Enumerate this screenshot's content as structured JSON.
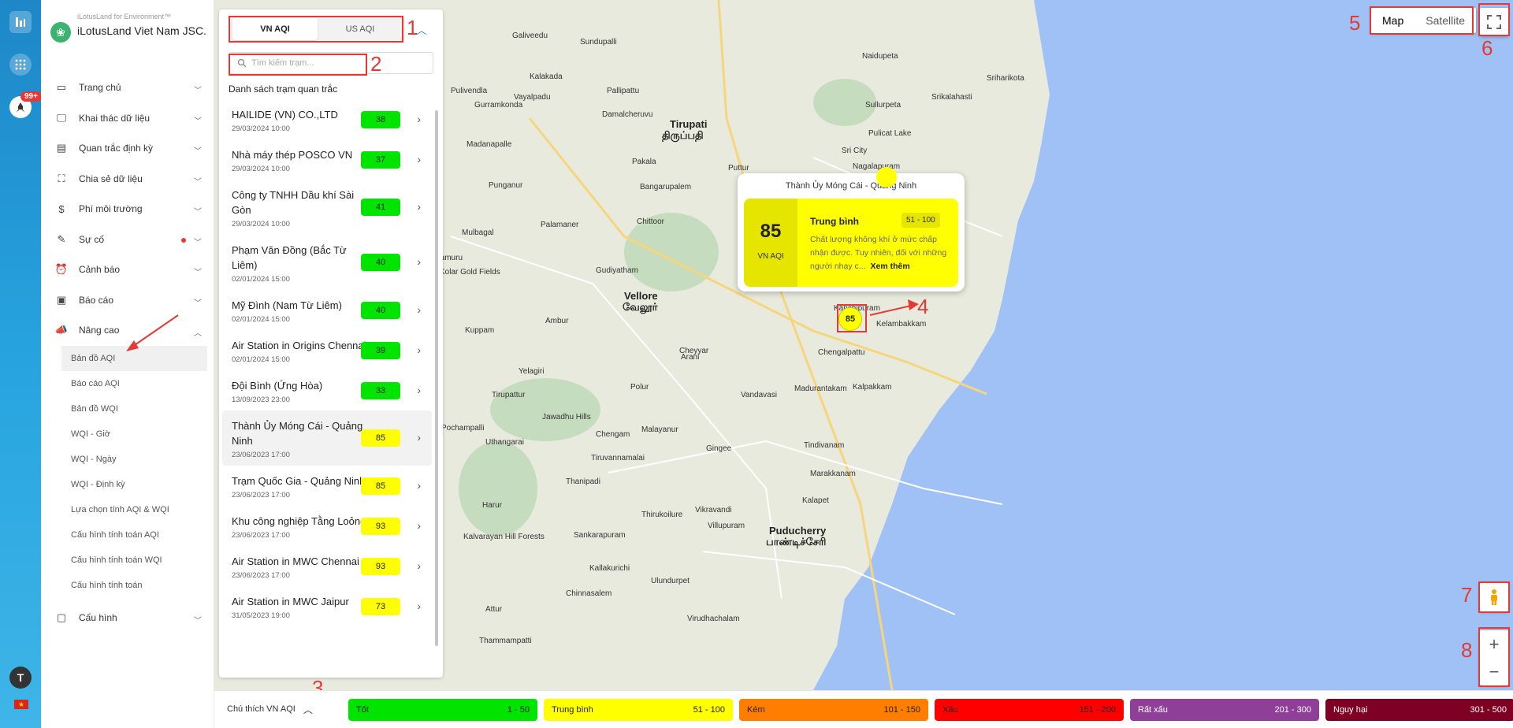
{
  "brand": {
    "subtitle": "iLotusLand for Environment™",
    "name": "iLotusLand Viet Nam JSC."
  },
  "rail": {
    "badge": "99+",
    "avatar": "T"
  },
  "menu": [
    {
      "label": "Trang chủ",
      "icon": "home-icon"
    },
    {
      "label": "Khai thác dữ liệu",
      "icon": "monitor-icon"
    },
    {
      "label": "Quan trắc định kỳ",
      "icon": "calendar-icon"
    },
    {
      "label": "Chia sẻ dữ liệu",
      "icon": "share-icon"
    },
    {
      "label": "Phí môi trường",
      "icon": "dollar-icon"
    },
    {
      "label": "Sự cố",
      "icon": "edit-icon"
    },
    {
      "label": "Cảnh báo",
      "icon": "alarm-icon"
    },
    {
      "label": "Báo cáo",
      "icon": "report-icon"
    },
    {
      "label": "Nâng cao",
      "icon": "megaphone-icon"
    }
  ],
  "submenu": [
    "Bản đồ AQI",
    "Báo cáo AQI",
    "Bản đồ WQI",
    "WQI - Giờ",
    "WQI - Ngày",
    "WQI - Định kỳ",
    "Lựa chọn tính AQI & WQI",
    "Cấu hình tính toán AQI",
    "Cấu hình tính toán WQI",
    "Cấu hình tính toán"
  ],
  "menu_last": {
    "label": "Cấu hình",
    "icon": "settings-icon"
  },
  "panel": {
    "tabs": [
      "VN AQI",
      "US AQI"
    ],
    "search_placeholder": "Tìm kiếm trạm...",
    "list_title": "Danh sách trạm quan trắc",
    "stations": [
      {
        "name": "HAILIDE (VN) CO.,LTD",
        "time": "29/03/2024 10:00",
        "value": "38",
        "color": "#00e400"
      },
      {
        "name": "Nhà máy thép POSCO VN",
        "time": "29/03/2024 10:00",
        "value": "37",
        "color": "#00e400"
      },
      {
        "name": "Công ty TNHH Dầu khí Sài Gòn",
        "time": "29/03/2024 10:00",
        "value": "41",
        "color": "#00e400"
      },
      {
        "name": "Phạm Văn Đồng (Bắc Từ Liêm)",
        "time": "02/01/2024 15:00",
        "value": "40",
        "color": "#00e400"
      },
      {
        "name": "Mỹ Đình (Nam Từ Liêm)",
        "time": "02/01/2024 15:00",
        "value": "40",
        "color": "#00e400"
      },
      {
        "name": "Air Station in Origins Chennai",
        "time": "02/01/2024 15:00",
        "value": "39",
        "color": "#00e400"
      },
      {
        "name": "Đội Bình (Ứng Hòa)",
        "time": "13/09/2023 23:00",
        "value": "33",
        "color": "#00e400"
      },
      {
        "name": "Thành Ủy Móng Cái - Quảng Ninh",
        "time": "23/06/2023 17:00",
        "value": "85",
        "color": "#ffff00"
      },
      {
        "name": "Trạm Quốc Gia - Quảng Ninh",
        "time": "23/06/2023 17:00",
        "value": "85",
        "color": "#ffff00"
      },
      {
        "name": "Khu công nghiệp Tằng Loỏng",
        "time": "23/06/2023 17:00",
        "value": "93",
        "color": "#ffff00"
      },
      {
        "name": "Air Station in MWC Chennai",
        "time": "23/06/2023 17:00",
        "value": "93",
        "color": "#ffff00"
      },
      {
        "name": "Air Station in MWC Jaipur",
        "time": "31/05/2023 19:00",
        "value": "73",
        "color": "#ffff00"
      }
    ]
  },
  "popup": {
    "title": "Thành Ủy Móng Cái - Quảng Ninh",
    "value": "85",
    "unit": "VN AQI",
    "level": "Trung bình",
    "range": "51 - 100",
    "description": "Chất lượng không khí ở mức chấp nhận được. Tuy nhiên, đối với những người nhạy c...",
    "more": "Xem thêm"
  },
  "marker": {
    "value": "85"
  },
  "maptype": {
    "map": "Map",
    "satellite": "Satellite"
  },
  "legend": {
    "toggle": "Chú thích VN AQI",
    "items": [
      {
        "label": "Tốt",
        "range": "1 - 50",
        "color": "#00e400",
        "text": "#222"
      },
      {
        "label": "Trung bình",
        "range": "51 - 100",
        "color": "#ffff00",
        "text": "#222"
      },
      {
        "label": "Kém",
        "range": "101 - 150",
        "color": "#ff7e00",
        "text": "#222"
      },
      {
        "label": "Xấu",
        "range": "151 - 200",
        "color": "#ff0000",
        "text": "#222"
      },
      {
        "label": "Rất xấu",
        "range": "201 - 300",
        "color": "#8f3f97",
        "text": "#fff"
      },
      {
        "label": "Nguy hại",
        "range": "301 - 500",
        "color": "#7e0023",
        "text": "#fff"
      }
    ]
  },
  "map_places": [
    {
      "name": "Tirupati",
      "big": true
    },
    {
      "name": "திருப்பதி",
      "big": true
    },
    {
      "name": "Vellore",
      "big": true
    },
    {
      "name": "வேலூர்",
      "big": true
    },
    {
      "name": "Puducherry",
      "big": true
    },
    {
      "name": "பாண்டிச்சேரி",
      "big": true
    },
    {
      "name": "Pulicat Lake",
      "big": false
    },
    {
      "name": "Kalakada",
      "big": false
    },
    {
      "name": "Madanapalle",
      "big": false
    },
    {
      "name": "Punganur",
      "big": false
    },
    {
      "name": "Chittoor",
      "big": false
    },
    {
      "name": "Palamaner",
      "big": false
    },
    {
      "name": "Mulbagal",
      "big": false
    },
    {
      "name": "Gudiyatham",
      "big": false
    },
    {
      "name": "Ambur",
      "big": false
    },
    {
      "name": "Kuppam",
      "big": false
    },
    {
      "name": "Kanchipuram",
      "big": false
    },
    {
      "name": "Chengalpattu",
      "big": false
    },
    {
      "name": "Kelambakkam",
      "big": false
    },
    {
      "name": "Cheyyar",
      "big": false
    },
    {
      "name": "Arani",
      "big": false
    },
    {
      "name": "Vandavasi",
      "big": false
    },
    {
      "name": "Madurantakam",
      "big": false
    },
    {
      "name": "Kalpakkam",
      "big": false
    },
    {
      "name": "Polur",
      "big": false
    },
    {
      "name": "Yelagiri",
      "big": false
    },
    {
      "name": "Tirupattur",
      "big": false
    },
    {
      "name": "Jawadhu Hills",
      "big": false
    },
    {
      "name": "Pochampalli",
      "big": false
    },
    {
      "name": "Uthangarai",
      "big": false
    },
    {
      "name": "Chengam",
      "big": false
    },
    {
      "name": "Malayanur",
      "big": false
    },
    {
      "name": "Tiruvannamalai",
      "big": false
    },
    {
      "name": "Gingee",
      "big": false
    },
    {
      "name": "Tindivanam",
      "big": false
    },
    {
      "name": "Marakkanam",
      "big": false
    },
    {
      "name": "Kalapet",
      "big": false
    },
    {
      "name": "Vikravandi",
      "big": false
    },
    {
      "name": "Villupuram",
      "big": false
    },
    {
      "name": "Thanipadi",
      "big": false
    },
    {
      "name": "Harur",
      "big": false
    },
    {
      "name": "Thirukoilure",
      "big": false
    },
    {
      "name": "Kalvarayan Hill Forests",
      "big": false
    },
    {
      "name": "Sankarapuram",
      "big": false
    },
    {
      "name": "Kallakurichi",
      "big": false
    },
    {
      "name": "Ulundurpet",
      "big": false
    },
    {
      "name": "Chinnasalem",
      "big": false
    },
    {
      "name": "Attur",
      "big": false
    },
    {
      "name": "Virudhachalam",
      "big": false
    },
    {
      "name": "Thammampatti",
      "big": false
    },
    {
      "name": "Sullurpeta",
      "big": false
    },
    {
      "name": "Naidupeta",
      "big": false
    },
    {
      "name": "Srikalahasti",
      "big": false
    },
    {
      "name": "Sri City",
      "big": false
    },
    {
      "name": "Puttur",
      "big": false
    },
    {
      "name": "Nagalapuram",
      "big": false
    },
    {
      "name": "Pakala",
      "big": false
    },
    {
      "name": "Galiveedu",
      "big": false
    },
    {
      "name": "Sundupalli",
      "big": false
    },
    {
      "name": "Pulivendla",
      "big": false
    },
    {
      "name": "Sriharikota",
      "big": false
    },
    {
      "name": "Pallipattu",
      "big": false
    },
    {
      "name": "Gurramkonda",
      "big": false
    },
    {
      "name": "Vayalpadu",
      "big": false
    },
    {
      "name": "Damalcheruvu",
      "big": false
    },
    {
      "name": "Bangarupalem",
      "big": false
    },
    {
      "name": "Pamuru",
      "big": false
    },
    {
      "name": "Kolar Gold Fields",
      "big": false
    }
  ]
}
